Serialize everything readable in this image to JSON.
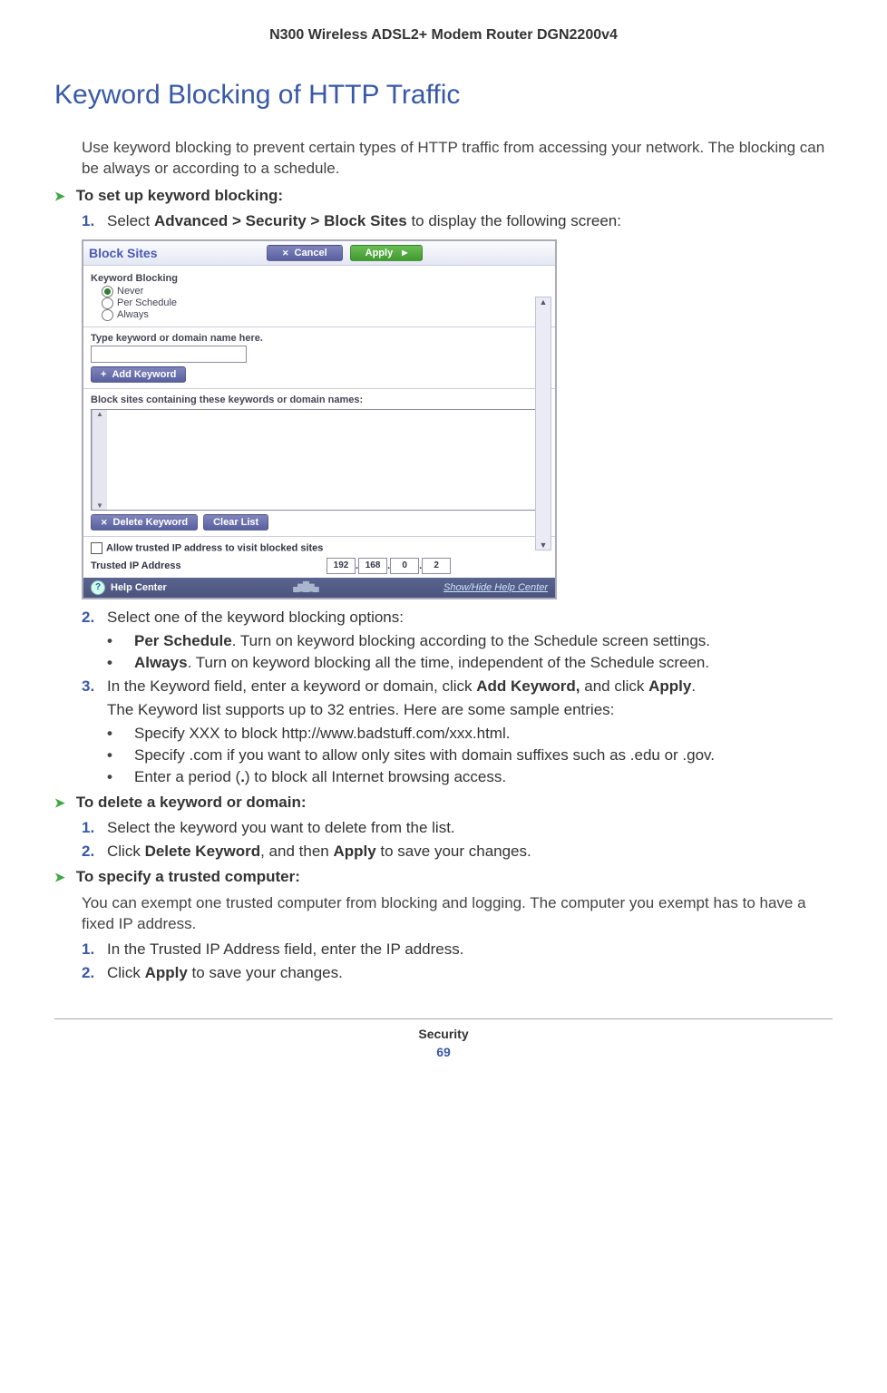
{
  "header": {
    "product": "N300 Wireless ADSL2+ Modem Router DGN2200v4"
  },
  "title": "Keyword Blocking of HTTP Traffic",
  "intro": "Use keyword blocking to prevent certain types of HTTP traffic from accessing your network. The blocking can be always or according to a schedule.",
  "proc1": {
    "heading": "To set up keyword blocking:",
    "step1": {
      "num": "1.",
      "prefix": "Select ",
      "bold": "Advanced > Security > Block Sites",
      "suffix": " to display the following screen:"
    },
    "step2": {
      "num": "2.",
      "text": "Select one of the keyword blocking options:"
    },
    "opt1": {
      "bold": "Per Schedule",
      "rest": ". Turn on keyword blocking according to the Schedule screen settings."
    },
    "opt2": {
      "bold": "Always",
      "rest": ". Turn on keyword blocking all the time, independent of the Schedule screen."
    },
    "step3": {
      "num": "3.",
      "prefix": "In the Keyword field, enter a keyword or domain, click ",
      "bold1": "Add Keyword,",
      "mid": " and click ",
      "bold2": "Apply",
      "suffix": "."
    },
    "note": "The Keyword list supports up to 32 entries. Here are some sample entries:",
    "sample1": "Specify XXX to block http://www.badstuff.com/xxx.html.",
    "sample2": "Specify .com if you want to allow only sites with domain suffixes such as .edu or .gov.",
    "sample3_a": "Enter a period (",
    "sample3_b": ".",
    "sample3_c": ") to block all Internet browsing access."
  },
  "proc2": {
    "heading": "To delete a keyword or domain:",
    "step1": {
      "num": "1.",
      "text": "Select the keyword you want to delete from the list."
    },
    "step2": {
      "num": "2.",
      "prefix": "Click ",
      "bold1": "Delete Keyword",
      "mid": ", and then ",
      "bold2": "Apply",
      "suffix": " to save your changes."
    }
  },
  "proc3": {
    "heading": "To specify a trusted computer:",
    "intro": "You can exempt one trusted computer from blocking and logging. The computer you exempt has to have a fixed IP address.",
    "step1": {
      "num": "1.",
      "text": "In the Trusted IP Address field, enter the IP address."
    },
    "step2": {
      "num": "2.",
      "prefix": "Click ",
      "bold": "Apply",
      "suffix": " to save your changes."
    }
  },
  "footer": {
    "chapter": "Security",
    "page": "69"
  },
  "ui": {
    "title": "Block Sites",
    "cancel": "Cancel",
    "apply": "Apply",
    "kb_heading": "Keyword Blocking",
    "never": "Never",
    "per_schedule": "Per Schedule",
    "always": "Always",
    "type_label": "Type keyword or domain name here.",
    "add_keyword": "Add Keyword",
    "block_label": "Block sites containing these keywords or domain names:",
    "delete_keyword": "Delete Keyword",
    "clear_list": "Clear List",
    "allow_trusted": "Allow trusted IP address to visit blocked sites",
    "trusted_label": "Trusted IP Address",
    "ip": {
      "a": "192",
      "b": "168",
      "c": "0",
      "d": "2"
    },
    "help": "Help Center",
    "help_toggle": "Show/Hide Help Center",
    "scroll_up": "▲",
    "scroll_down": "▼"
  }
}
